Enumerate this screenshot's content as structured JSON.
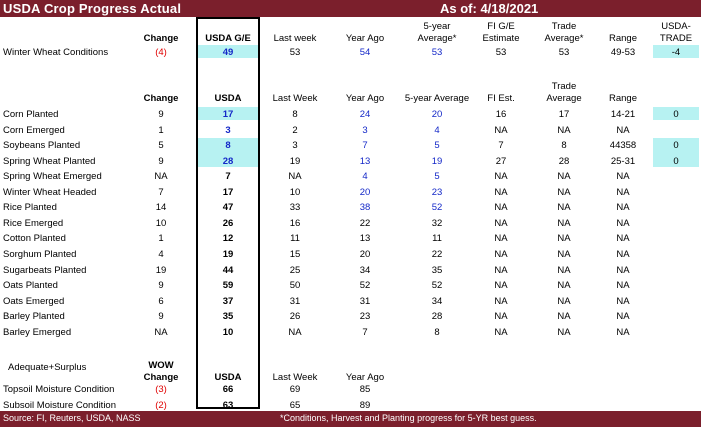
{
  "header": {
    "title": "USDA Crop Progress Actual",
    "as_of": "As of:  4/18/2021"
  },
  "footer": {
    "source": "Source: FI, Reuters, USDA, NASS",
    "note": "*Conditions, Harvest and Planting progress for 5-YR best guess."
  },
  "conditions_header": {
    "change": "Change",
    "usda": "USDA G/E",
    "last_week": "Last week",
    "year_ago": "Year Ago",
    "avg5": "5-year\nAverage*",
    "fi": "FI G/E\nEstimate",
    "trade": "Trade\nAverage*",
    "range": "Range",
    "usda_trade": "USDA-\nTRADE"
  },
  "conditions_rows": [
    {
      "label": "Winter Wheat Conditions",
      "change": "(4)",
      "usda": "49",
      "last_week": "53",
      "year_ago": "54",
      "avg5": "53",
      "fi": "53",
      "trade": "53",
      "range": "49-53",
      "usda_trade": "-4"
    }
  ],
  "progress_header": {
    "change": "Change",
    "usda": "USDA",
    "last_week": "Last Week",
    "year_ago": "Year Ago",
    "avg5": "5-year Average",
    "fi": "FI Est.",
    "trade": "Trade\nAverage",
    "range": "Range"
  },
  "progress_rows": [
    {
      "label": "Corn Planted",
      "change": "9",
      "usda": "17",
      "last_week": "8",
      "year_ago": "24",
      "avg5": "20",
      "fi": "16",
      "trade": "17",
      "range": "14-21",
      "usda_trade": "0"
    },
    {
      "label": "Corn Emerged",
      "change": "1",
      "usda": "3",
      "last_week": "2",
      "year_ago": "3",
      "avg5": "4",
      "fi": "NA",
      "trade": "NA",
      "range": "NA",
      "usda_trade": ""
    },
    {
      "label": "Soybeans Planted",
      "change": "5",
      "usda": "8",
      "last_week": "3",
      "year_ago": "7",
      "avg5": "5",
      "fi": "7",
      "trade": "8",
      "range": "44358",
      "usda_trade": "0"
    },
    {
      "label": "Spring Wheat Planted",
      "change": "9",
      "usda": "28",
      "last_week": "19",
      "year_ago": "13",
      "avg5": "19",
      "fi": "27",
      "trade": "28",
      "range": "25-31",
      "usda_trade": "0"
    },
    {
      "label": "Spring Wheat Emerged",
      "change": "NA",
      "usda": "7",
      "last_week": "NA",
      "year_ago": "4",
      "avg5": "5",
      "fi": "NA",
      "trade": "NA",
      "range": "NA",
      "usda_trade": ""
    },
    {
      "label": "Winter Wheat Headed",
      "change": "7",
      "usda": "17",
      "last_week": "10",
      "year_ago": "20",
      "avg5": "23",
      "fi": "NA",
      "trade": "NA",
      "range": "NA",
      "usda_trade": ""
    },
    {
      "label": "Rice Planted",
      "change": "14",
      "usda": "47",
      "last_week": "33",
      "year_ago": "38",
      "avg5": "52",
      "fi": "NA",
      "trade": "NA",
      "range": "NA",
      "usda_trade": ""
    },
    {
      "label": "Rice Emerged",
      "change": "10",
      "usda": "26",
      "last_week": "16",
      "year_ago": "22",
      "avg5": "32",
      "fi": "NA",
      "trade": "NA",
      "range": "NA",
      "usda_trade": ""
    },
    {
      "label": "Cotton Planted",
      "change": "1",
      "usda": "12",
      "last_week": "11",
      "year_ago": "13",
      "avg5": "11",
      "fi": "NA",
      "trade": "NA",
      "range": "NA",
      "usda_trade": ""
    },
    {
      "label": "Sorghum Planted",
      "change": "4",
      "usda": "19",
      "last_week": "15",
      "year_ago": "20",
      "avg5": "22",
      "fi": "NA",
      "trade": "NA",
      "range": "NA",
      "usda_trade": ""
    },
    {
      "label": "Sugarbeats Planted",
      "change": "19",
      "usda": "44",
      "last_week": "25",
      "year_ago": "34",
      "avg5": "35",
      "fi": "NA",
      "trade": "NA",
      "range": "NA",
      "usda_trade": ""
    },
    {
      "label": "Oats Planted",
      "change": "9",
      "usda": "59",
      "last_week": "50",
      "year_ago": "52",
      "avg5": "52",
      "fi": "NA",
      "trade": "NA",
      "range": "NA",
      "usda_trade": ""
    },
    {
      "label": "Oats Emerged",
      "change": "6",
      "usda": "37",
      "last_week": "31",
      "year_ago": "31",
      "avg5": "34",
      "fi": "NA",
      "trade": "NA",
      "range": "NA",
      "usda_trade": ""
    },
    {
      "label": "Barley Planted",
      "change": "9",
      "usda": "35",
      "last_week": "26",
      "year_ago": "23",
      "avg5": "28",
      "fi": "NA",
      "trade": "NA",
      "range": "NA",
      "usda_trade": ""
    },
    {
      "label": "Barley Emerged",
      "change": "NA",
      "usda": "10",
      "last_week": "NA",
      "year_ago": "7",
      "avg5": "8",
      "fi": "NA",
      "trade": "NA",
      "range": "NA",
      "usda_trade": ""
    }
  ],
  "moisture_header": {
    "section": "Adequate+Surplus",
    "change": "WOW\nChange",
    "usda": "USDA",
    "last_week": "Last Week",
    "year_ago": "Year Ago"
  },
  "moisture_rows": [
    {
      "label": "Topsoil Moisture Condition",
      "change": "(3)",
      "usda": "66",
      "last_week": "69",
      "year_ago": "85"
    },
    {
      "label": "Subsoil Moisture Condition",
      "change": "(2)",
      "usda": "63",
      "last_week": "65",
      "year_ago": "89"
    }
  ],
  "colors": {
    "bar": "#7b1f2c",
    "highlight": "#b7f2f2",
    "negative": "#e00000",
    "usda_blue": "#1428c8"
  }
}
